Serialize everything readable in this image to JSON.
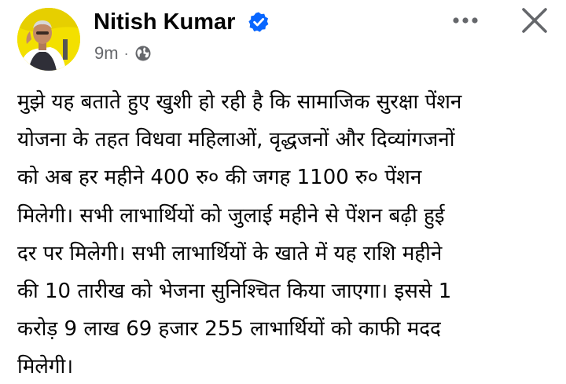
{
  "post": {
    "author": "Nitish Kumar",
    "verified_icon": "verified-badge-icon",
    "timestamp": "9m",
    "separator": "·",
    "privacy_icon": "globe-icon",
    "more_icon": "more-horizontal-icon",
    "close_icon": "close-icon",
    "text_lines": [
      "मुझे यह बताते हुए खुशी हो रही है कि सामाजिक सुरक्षा पेंशन",
      "योजना के तहत विधवा महिलाओं, वृद्धजनों और दिव्यांगजनों",
      "को अब हर महीने 400 रु० की जगह 1100 रु० पेंशन",
      "मिलेगी। सभी लाभार्थियों को जुलाई महीने से पेंशन बढ़ी हुई",
      "दर पर मिलेगी। सभी लाभार्थियों के खाते में यह राशि महीने",
      "की 10 तारीख को भेजना सुनिश्चित किया जाएगा। इससे 1",
      "करोड़ 9 लाख 69 हजार 255 लाभार्थियों को काफी मदद",
      "मिलेगी।"
    ]
  },
  "colors": {
    "text": "#050505",
    "secondary_text": "#65676b",
    "verified_blue": "#0866ff",
    "icon_gray": "#65676b",
    "avatar_background": "#f3e000"
  }
}
